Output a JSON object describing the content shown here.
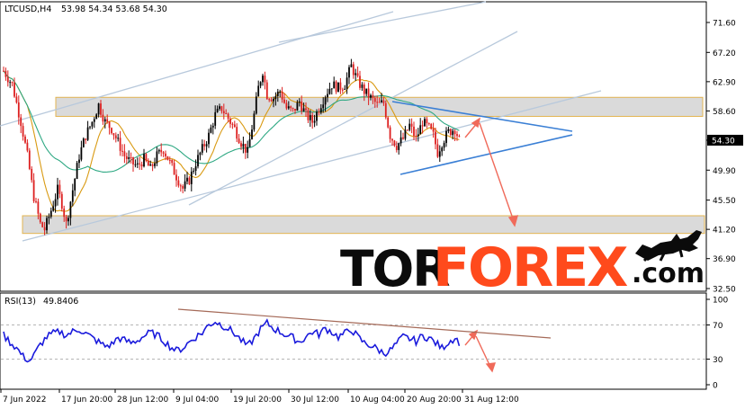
{
  "chart_data": [
    {
      "type": "candlestick",
      "title": "LTCUSD,H4",
      "ohlc_label": "53.98 54.34 53.68 54.30",
      "current_price": "54.30",
      "x_tick_labels": [
        "7 Jun 2022",
        "17 Jun 20:00",
        "28 Jun 12:00",
        "9 Jul 04:00",
        "19 Jul 20:00",
        "30 Jul 12:00",
        "10 Aug 04:00",
        "20 Aug 20:00",
        "31 Aug 12:00"
      ],
      "y_tick_labels": [
        "71.60",
        "67.20",
        "62.90",
        "58.60",
        "54.30",
        "49.90",
        "45.50",
        "41.20",
        "36.90",
        "32.50"
      ],
      "ylim": [
        32.5,
        73.8
      ],
      "price_path": [
        [
          0,
          64.5
        ],
        [
          4,
          62.5
        ],
        [
          8,
          57
        ],
        [
          11,
          52
        ],
        [
          14,
          46
        ],
        [
          17,
          42
        ],
        [
          19,
          41.2
        ],
        [
          22,
          44
        ],
        [
          25,
          47
        ],
        [
          27,
          45
        ],
        [
          29,
          42
        ],
        [
          32,
          47
        ],
        [
          35,
          52
        ],
        [
          38,
          55
        ],
        [
          41,
          57
        ],
        [
          44,
          59.5
        ],
        [
          47,
          57
        ],
        [
          50,
          56
        ],
        [
          53,
          54
        ],
        [
          56,
          52
        ],
        [
          59,
          51
        ],
        [
          62,
          50.5
        ],
        [
          65,
          51.5
        ],
        [
          68,
          50
        ],
        [
          71,
          52
        ],
        [
          74,
          53
        ],
        [
          77,
          51
        ],
        [
          80,
          49
        ],
        [
          83,
          47.2
        ],
        [
          86,
          48.5
        ],
        [
          89,
          51
        ],
        [
          92,
          53
        ],
        [
          95,
          55
        ],
        [
          98,
          58
        ],
        [
          101,
          59
        ],
        [
          104,
          57.5
        ],
        [
          107,
          56
        ],
        [
          110,
          54
        ],
        [
          113,
          52.5
        ],
        [
          116,
          58
        ],
        [
          118,
          62
        ],
        [
          120,
          64.5
        ],
        [
          122,
          61
        ],
        [
          125,
          60.5
        ],
        [
          128,
          61.5
        ],
        [
          131,
          59
        ],
        [
          134,
          58.5
        ],
        [
          137,
          60
        ],
        [
          140,
          58
        ],
        [
          143,
          57
        ],
        [
          146,
          59
        ],
        [
          149,
          61
        ],
        [
          152,
          62.5
        ],
        [
          155,
          62
        ],
        [
          158,
          62.5
        ],
        [
          161,
          65.2
        ],
        [
          164,
          63
        ],
        [
          167,
          61.5
        ],
        [
          170,
          60.5
        ],
        [
          173,
          59.5
        ],
        [
          176,
          59.8
        ],
        [
          179,
          55
        ],
        [
          182,
          53.5
        ],
        [
          185,
          54.5
        ],
        [
          188,
          56.5
        ],
        [
          191,
          54.5
        ],
        [
          194,
          57
        ],
        [
          197,
          56
        ],
        [
          199,
          55
        ],
        [
          201,
          52.5
        ],
        [
          203,
          54
        ],
        [
          206,
          55.5
        ],
        [
          209,
          56
        ],
        [
          211,
          54.3
        ]
      ],
      "series": [
        {
          "name": "RSI(13)",
          "value_label": "49.8406"
        }
      ],
      "rsi_tick_labels": [
        "100",
        "70",
        "30",
        "0"
      ],
      "rsi_levels": [
        70,
        30
      ],
      "rsi_ylim": [
        0,
        100
      ],
      "rsi_path": [
        [
          0,
          58
        ],
        [
          3,
          50
        ],
        [
          6,
          43
        ],
        [
          9,
          33
        ],
        [
          12,
          28
        ],
        [
          14,
          34
        ],
        [
          17,
          47
        ],
        [
          20,
          56
        ],
        [
          23,
          60
        ],
        [
          26,
          62
        ],
        [
          29,
          58
        ],
        [
          32,
          62
        ],
        [
          35,
          65
        ],
        [
          38,
          60
        ],
        [
          41,
          55
        ],
        [
          44,
          50
        ],
        [
          47,
          45
        ],
        [
          50,
          47
        ],
        [
          53,
          55
        ],
        [
          56,
          52
        ],
        [
          59,
          49
        ],
        [
          62,
          52
        ],
        [
          65,
          57
        ],
        [
          68,
          61
        ],
        [
          71,
          58
        ],
        [
          74,
          52
        ],
        [
          77,
          45
        ],
        [
          80,
          40
        ],
        [
          83,
          43
        ],
        [
          86,
          50
        ],
        [
          89,
          56
        ],
        [
          92,
          61
        ],
        [
          95,
          70
        ],
        [
          98,
          74
        ],
        [
          101,
          70
        ],
        [
          104,
          66
        ],
        [
          107,
          60
        ],
        [
          110,
          52
        ],
        [
          113,
          45
        ],
        [
          116,
          54
        ],
        [
          119,
          65
        ],
        [
          122,
          72
        ],
        [
          125,
          66
        ],
        [
          128,
          62
        ],
        [
          131,
          58
        ],
        [
          134,
          55
        ],
        [
          137,
          50
        ],
        [
          140,
          56
        ],
        [
          143,
          62
        ],
        [
          146,
          59
        ],
        [
          149,
          66
        ],
        [
          152,
          62
        ],
        [
          155,
          56
        ],
        [
          158,
          60
        ],
        [
          161,
          65
        ],
        [
          164,
          56
        ],
        [
          167,
          49
        ],
        [
          170,
          46
        ],
        [
          173,
          42
        ],
        [
          176,
          37
        ],
        [
          179,
          40
        ],
        [
          182,
          48
        ],
        [
          185,
          56
        ],
        [
          188,
          54
        ],
        [
          191,
          51
        ],
        [
          194,
          57
        ],
        [
          197,
          55
        ],
        [
          200,
          49
        ],
        [
          203,
          43
        ],
        [
          206,
          50
        ],
        [
          209,
          55
        ],
        [
          211,
          49.8
        ]
      ],
      "support_zone": [
        40.6,
        43.2
      ],
      "resistance_zone": [
        57.8,
        60.6
      ],
      "watermark": {
        "part1": "TOR",
        "part2": "FOREX",
        "part3": ".com"
      },
      "colors": {
        "bull_candle": "#000000",
        "bear_candle": "#dd1f1f",
        "ma_fast": "#d99a12",
        "ma_slow": "#2ea883",
        "channel_lines": "#b8c9dc",
        "triangle_lines": "#3a7fd5",
        "forecast_arrow": "#f06a5a",
        "rsi_line": "#1a1adc",
        "rsi_trendline": "#a56a58",
        "zone_fill": "#d6d6d6",
        "zone_border": "#e3b451",
        "watermark_orange": "#ff4a1c"
      }
    }
  ]
}
